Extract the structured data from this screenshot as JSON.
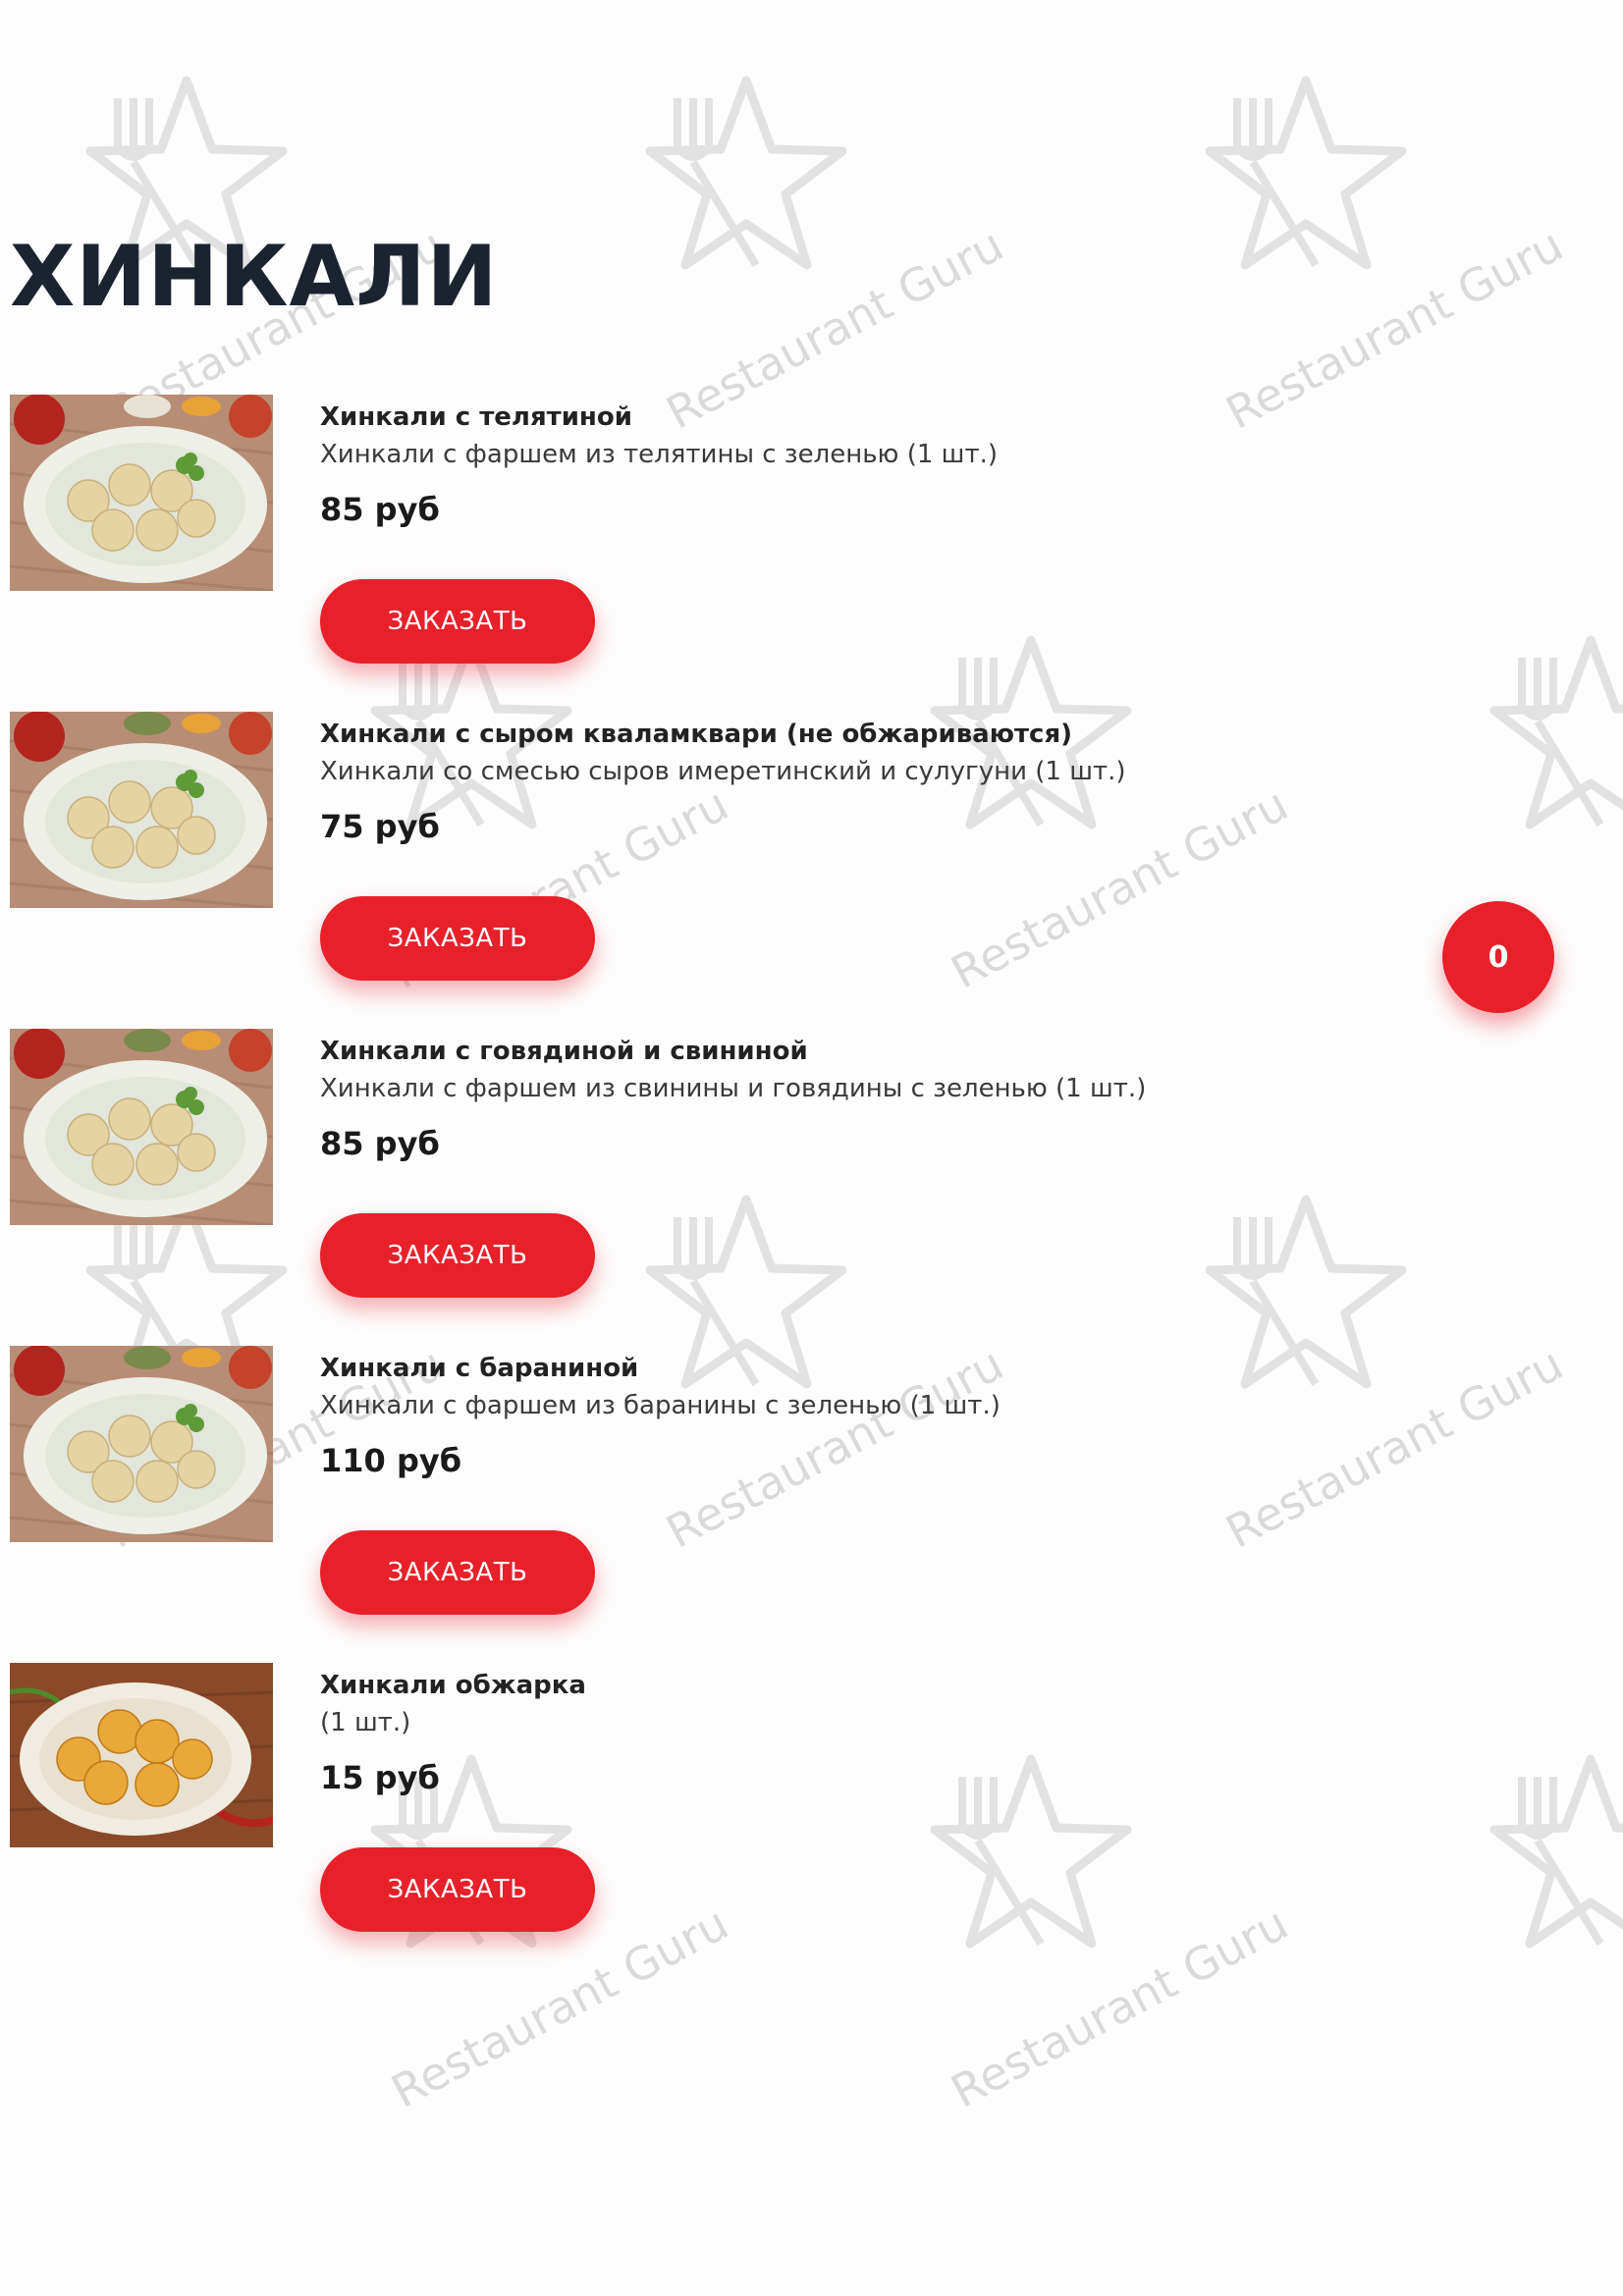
{
  "section": {
    "title": "ХИНКАЛИ"
  },
  "watermark": {
    "text": "Restaurant Guru"
  },
  "colors": {
    "accent": "#e8202a",
    "title": "#1b2330",
    "background": "#fdfdfd"
  },
  "items": [
    {
      "name": "Хинкали с телятиной",
      "description": "Хинкали с фаршем из телятины с зеленью (1 шт.)",
      "price": "85 руб",
      "button_label": "ЗАКАЗАТЬ",
      "photo": "dumplings-plate"
    },
    {
      "name": "Хинкали с сыром кваламквари (не обжариваются)",
      "description": "Хинкали со смесью сыров имеретинский и сулугуни (1 шт.)",
      "price": "75 руб",
      "button_label": "ЗАКАЗАТЬ",
      "photo": "dumplings-plate"
    },
    {
      "name": "Хинкали с говядиной и свининой",
      "description": "Хинкали с фаршем из свинины и говядины с зеленью (1 шт.)",
      "price": "85 руб",
      "button_label": "ЗАКАЗАТЬ",
      "photo": "dumplings-plate"
    },
    {
      "name": "Хинкали с бараниной",
      "description": "Хинкали с фаршем из баранины с зеленью (1 шт.)",
      "price": "110 руб",
      "button_label": "ЗАКАЗАТЬ",
      "photo": "dumplings-plate"
    },
    {
      "name": "Хинкали обжарка",
      "description": "(1 шт.)",
      "price": "15 руб",
      "button_label": "ЗАКАЗАТЬ",
      "photo": "fried-dumplings-plate"
    }
  ],
  "cart": {
    "count": "0",
    "icon": "cart-count-badge"
  }
}
